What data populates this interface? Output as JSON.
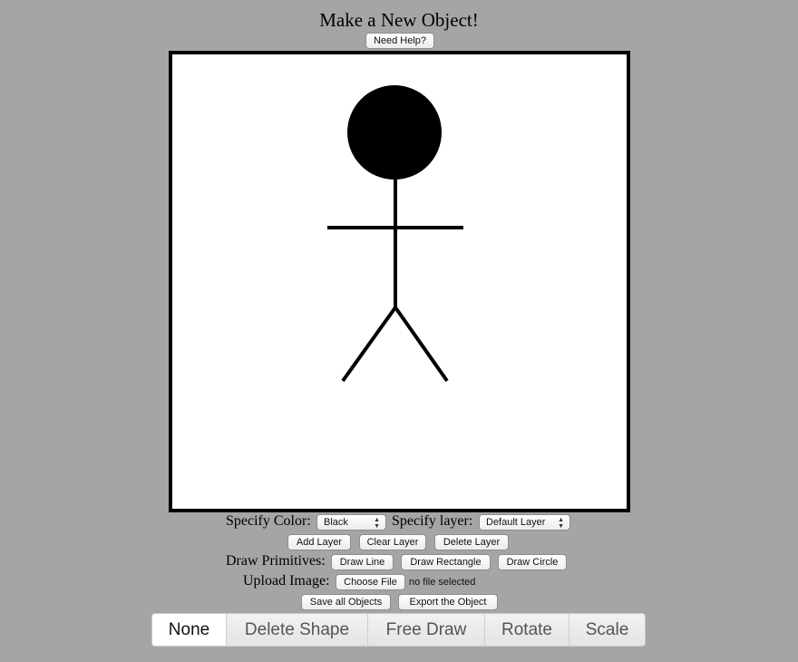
{
  "header": {
    "title": "Make a New Object!",
    "help_label": "Need Help?"
  },
  "controls": {
    "color_label": "Specify Color:",
    "color_value": "Black",
    "layer_label": "Specify layer:",
    "layer_value": "Default Layer",
    "add_layer_label": "Add Layer",
    "clear_layer_label": "Clear Layer",
    "delete_layer_label": "Delete Layer",
    "primitives_label": "Draw Primitives:",
    "draw_line_label": "Draw Line",
    "draw_rectangle_label": "Draw Rectangle",
    "draw_circle_label": "Draw Circle",
    "upload_label": "Upload Image:",
    "choose_file_label": "Choose File",
    "file_status": "no file selected",
    "save_all_label": "Save all Objects",
    "export_label": "Export the Object"
  },
  "drawing": {
    "stroke_color": "#000000",
    "fill_color": "#000000",
    "background": "#ffffff"
  },
  "tabs": [
    {
      "label": "None",
      "active": true
    },
    {
      "label": "Delete Shape",
      "active": false
    },
    {
      "label": "Free Draw",
      "active": false
    },
    {
      "label": "Rotate",
      "active": false
    },
    {
      "label": "Scale",
      "active": false
    }
  ]
}
